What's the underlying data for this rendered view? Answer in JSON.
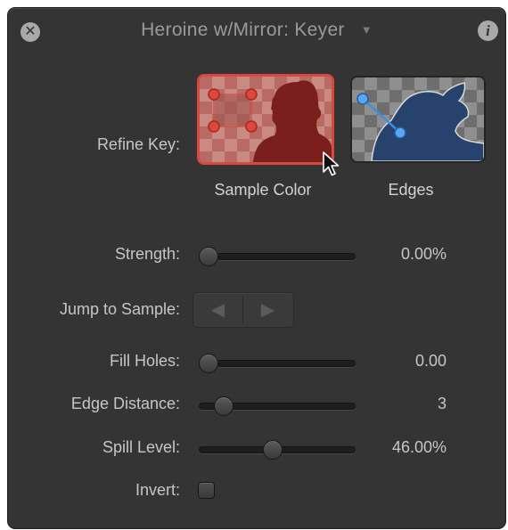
{
  "window": {
    "title": "Heroine w/Mirror: Keyer",
    "close_icon": "close-icon",
    "info_icon": "info-icon",
    "title_menu_icon": "chevron-down-icon"
  },
  "refine_key": {
    "label": "Refine Key:",
    "sample_color": {
      "caption": "Sample Color",
      "selected": true,
      "icon": "sample-color-silhouette-icon"
    },
    "edges": {
      "caption": "Edges",
      "selected": false,
      "icon": "edges-silhouette-icon"
    }
  },
  "controls": {
    "strength": {
      "label": "Strength:",
      "value_text": "0.00%",
      "level": 0.0
    },
    "jump_to_sample": {
      "label": "Jump to Sample:",
      "prev_icon": "triangle-left-icon",
      "next_icon": "triangle-right-icon",
      "enabled": false
    },
    "fill_holes": {
      "label": "Fill Holes:",
      "value_text": "0.00",
      "level": 0.0
    },
    "edge_distance": {
      "label": "Edge Distance:",
      "value_text": "3",
      "level": 0.11
    },
    "spill_level": {
      "label": "Spill Level:",
      "value_text": "46.00%",
      "level": 0.46
    },
    "invert": {
      "label": "Invert:",
      "checked": false
    }
  },
  "colors": {
    "panel": "#343434",
    "selection_red": "#d8483c",
    "edge_blue": "#3f8fe0",
    "silhouette_red": "#7a1f1c",
    "silhouette_blue": "#27426d"
  }
}
